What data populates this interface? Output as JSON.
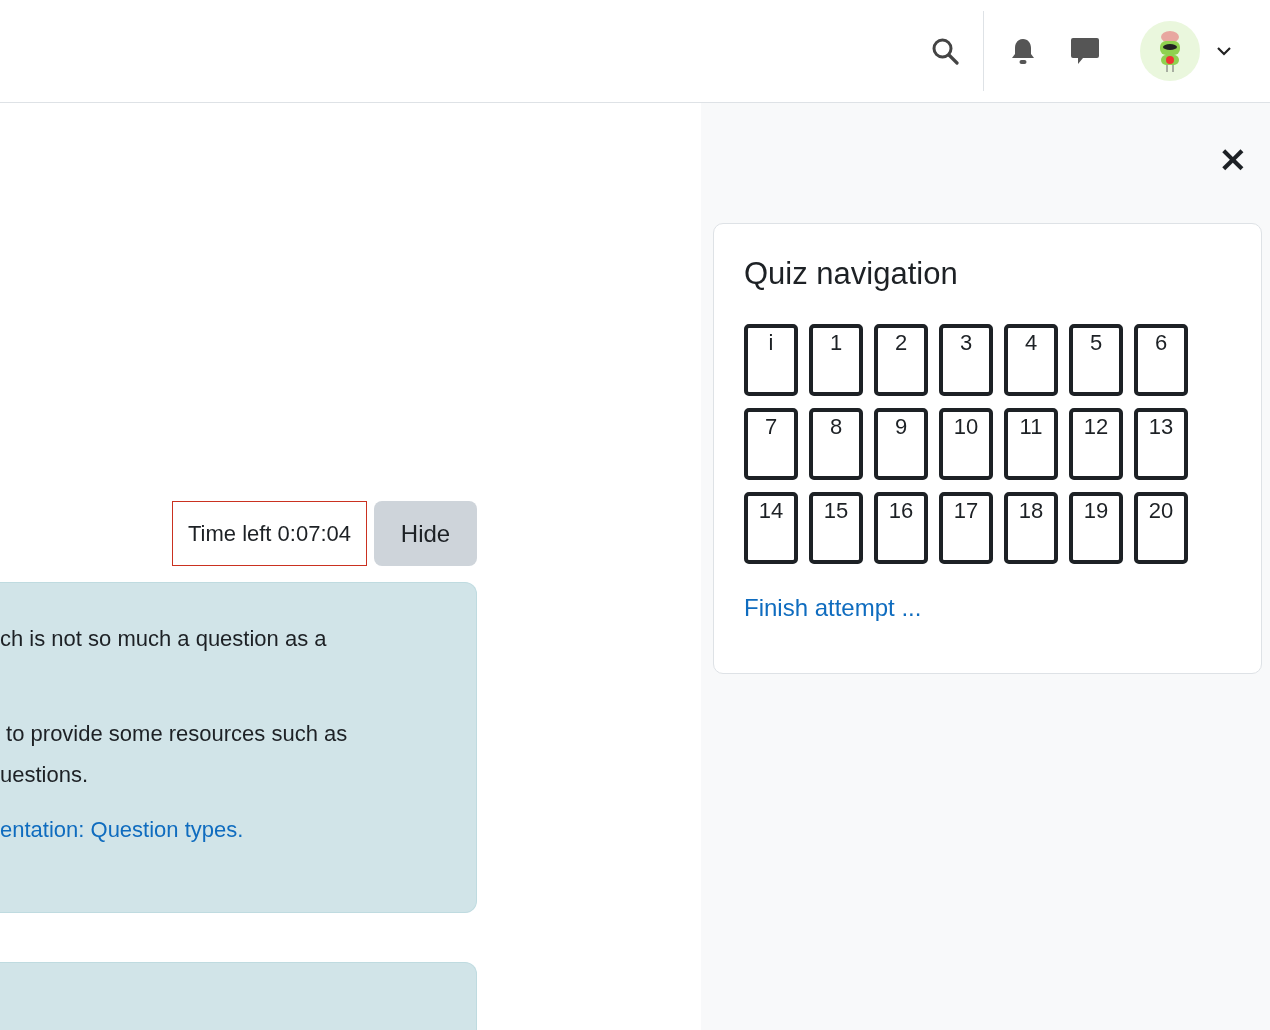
{
  "timer": {
    "text": "Time left 0:07:04",
    "warning": true
  },
  "hide_button": "Hide",
  "info_box": {
    "paragraphs": [
      {
        "kind": "text",
        "lines": [
          "ch is not so much a question as a"
        ]
      },
      {
        "kind": "text",
        "lines": [
          " to provide some resources such as",
          "uestions."
        ]
      },
      {
        "kind": "link",
        "lines": [
          "entation: Question types."
        ]
      }
    ]
  },
  "drawer": {
    "close": "×"
  },
  "quiz_navigation": {
    "title": "Quiz navigation",
    "buttons": [
      {
        "label": "i",
        "selected": false
      },
      {
        "label": "1",
        "selected": false
      },
      {
        "label": "2",
        "selected": false
      },
      {
        "label": "3",
        "selected": false
      },
      {
        "label": "4",
        "selected": false
      },
      {
        "label": "5",
        "selected": false
      },
      {
        "label": "6",
        "selected": false
      },
      {
        "label": "7",
        "selected": false
      },
      {
        "label": "8",
        "selected": false
      },
      {
        "label": "9",
        "selected": false
      },
      {
        "label": "10",
        "selected": false
      },
      {
        "label": "11",
        "selected": false
      },
      {
        "label": "12",
        "selected": false
      },
      {
        "label": "13",
        "selected": false
      },
      {
        "label": "14",
        "selected": false
      },
      {
        "label": "15",
        "selected": false
      },
      {
        "label": "16",
        "selected": false
      },
      {
        "label": "17",
        "selected": false
      },
      {
        "label": "18",
        "selected": false
      },
      {
        "label": "19",
        "selected": false
      },
      {
        "label": "20",
        "selected": false
      }
    ],
    "finish_link": "Finish attempt ..."
  }
}
